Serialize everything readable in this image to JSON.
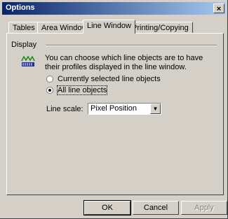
{
  "window": {
    "title": "Options",
    "close_glyph": "×"
  },
  "tabs": [
    {
      "label": "Tables",
      "active": false
    },
    {
      "label": "Area Window",
      "active": false
    },
    {
      "label": "Line Window",
      "active": true
    },
    {
      "label": "Printing/Copying",
      "active": false
    }
  ],
  "display_group": {
    "label": "Display",
    "icon": "line-window-icon",
    "description": "You can choose which line objects are to have their profiles displayed in the line window.",
    "radio_options": [
      {
        "label": "Currently selected line objects",
        "checked": false
      },
      {
        "label": "All line objects",
        "checked": true
      }
    ],
    "line_scale": {
      "label": "Line scale:",
      "value": "Pixel Position"
    }
  },
  "buttons": {
    "ok": "OK",
    "cancel": "Cancel",
    "apply": "Apply"
  },
  "colors": {
    "face": "#d4d0c8",
    "title_start": "#0a246a",
    "title_end": "#a6caf0",
    "icon_green": "#1a8a1a",
    "icon_blue": "#1c2ea0"
  }
}
